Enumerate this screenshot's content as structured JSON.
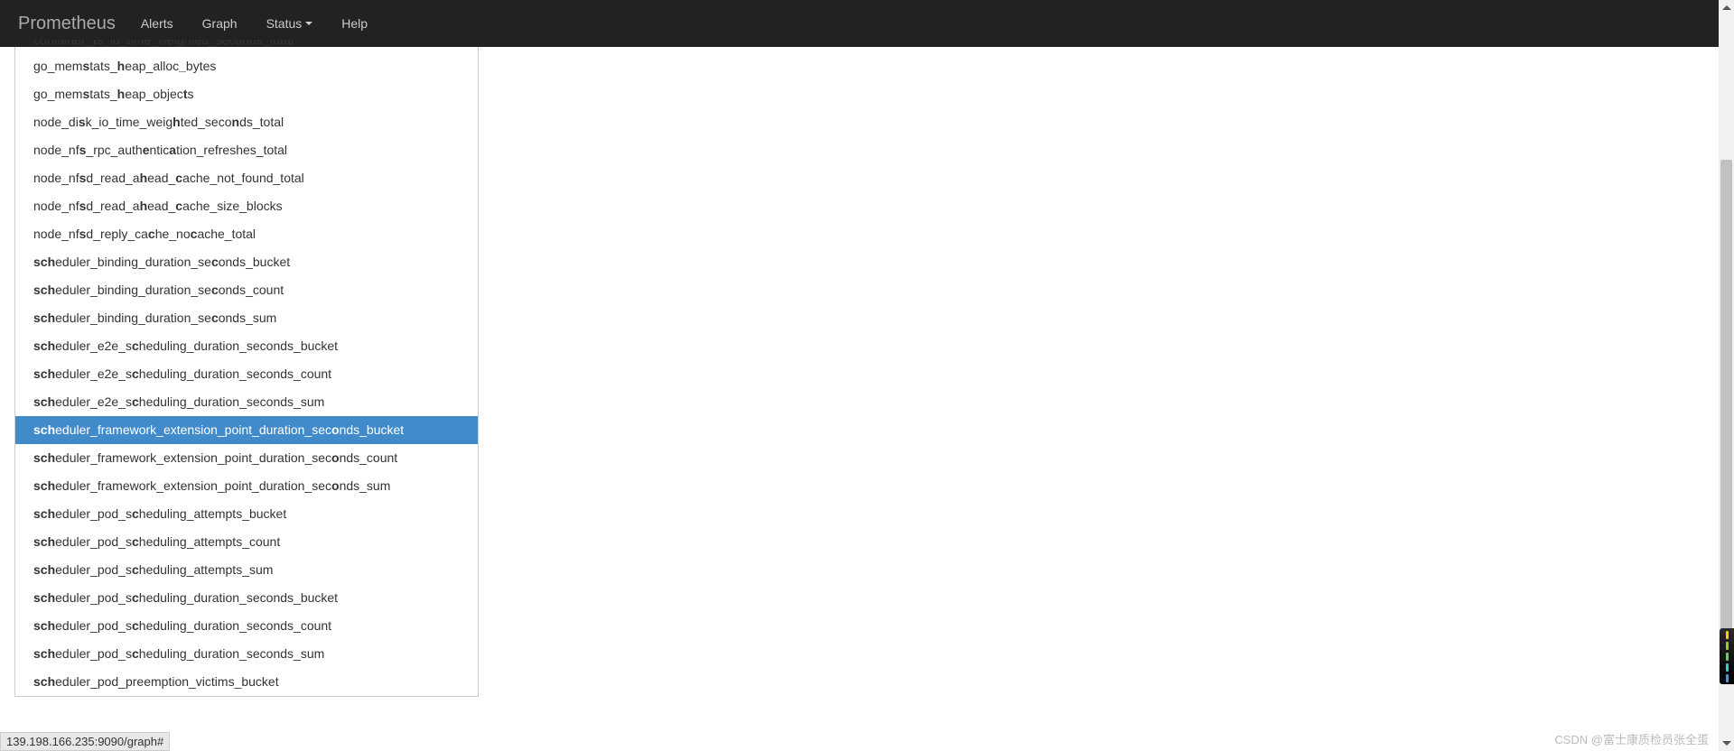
{
  "navbar": {
    "brand": "Prometheus",
    "items": [
      "Alerts",
      "Graph",
      "Status",
      "Help"
    ],
    "dropdown_index": 2
  },
  "autocomplete": {
    "selected_index": 14,
    "items": [
      {
        "text": "container_fs_io_time_weighted_seconds_total",
        "bold": [
          10,
          11,
          27,
          28,
          37,
          38
        ],
        "cut": true
      },
      {
        "text": "go_memstats_heap_alloc_bytes",
        "bold": [
          6,
          7,
          12,
          13,
          22,
          23
        ]
      },
      {
        "text": "go_memstats_heap_objects",
        "bold": [
          6,
          7,
          12,
          13,
          22,
          23
        ]
      },
      {
        "text": "node_disk_io_time_weighted_seconds_total",
        "bold": [
          7,
          8,
          22,
          23,
          31,
          32
        ]
      },
      {
        "text": "node_nfs_rpc_authentication_refreshes_total",
        "bold": [
          7,
          8,
          17,
          18,
          22,
          23
        ]
      },
      {
        "text": "node_nfsd_read_ahead_cache_not_found_total",
        "bold": [
          7,
          8,
          16,
          17,
          21,
          22
        ]
      },
      {
        "text": "node_nfsd_read_ahead_cache_size_blocks",
        "bold": [
          7,
          8,
          16,
          17,
          21,
          22
        ]
      },
      {
        "text": "node_nfsd_reply_cache_nocache_total",
        "bold": [
          7,
          8,
          18,
          19,
          24,
          25
        ]
      },
      {
        "text": "scheduler_binding_duration_seconds_bucket",
        "bold": [
          0,
          3,
          29,
          30
        ]
      },
      {
        "text": "scheduler_binding_duration_seconds_count",
        "bold": [
          0,
          3,
          29,
          30
        ]
      },
      {
        "text": "scheduler_binding_duration_seconds_sum",
        "bold": [
          0,
          3,
          29,
          30
        ]
      },
      {
        "text": "scheduler_e2e_scheduling_duration_seconds_bucket",
        "bold": [
          0,
          3,
          15,
          16
        ]
      },
      {
        "text": "scheduler_e2e_scheduling_duration_seconds_count",
        "bold": [
          0,
          3,
          15,
          16
        ]
      },
      {
        "text": "scheduler_e2e_scheduling_duration_seconds_sum",
        "bold": [
          0,
          3,
          15,
          16
        ]
      },
      {
        "text": "scheduler_framework_extension_point_duration_seconds_bucket",
        "bold": [
          0,
          3,
          48,
          49
        ]
      },
      {
        "text": "scheduler_framework_extension_point_duration_seconds_count",
        "bold": [
          0,
          3,
          48,
          49
        ]
      },
      {
        "text": "scheduler_framework_extension_point_duration_seconds_sum",
        "bold": [
          0,
          3,
          48,
          49
        ]
      },
      {
        "text": "scheduler_pod_scheduling_attempts_bucket",
        "bold": [
          0,
          3,
          15,
          16
        ]
      },
      {
        "text": "scheduler_pod_scheduling_attempts_count",
        "bold": [
          0,
          3,
          15,
          16
        ]
      },
      {
        "text": "scheduler_pod_scheduling_attempts_sum",
        "bold": [
          0,
          3,
          15,
          16
        ]
      },
      {
        "text": "scheduler_pod_scheduling_duration_seconds_bucket",
        "bold": [
          0,
          3,
          15,
          16
        ]
      },
      {
        "text": "scheduler_pod_scheduling_duration_seconds_count",
        "bold": [
          0,
          3,
          15,
          16
        ]
      },
      {
        "text": "scheduler_pod_scheduling_duration_seconds_sum",
        "bold": [
          0,
          3,
          15,
          16
        ]
      },
      {
        "text": "scheduler_pod_preemption_victims_bucket",
        "bold": [
          0,
          3
        ]
      }
    ]
  },
  "status_bar": "139.198.166.235:9090/graph#",
  "watermark": "CSDN @富士康质检员张全蛋",
  "gadget_colors": [
    "#ffcc00",
    "#99cc33",
    "#66cc66",
    "#33cccc",
    "#3399ff"
  ]
}
